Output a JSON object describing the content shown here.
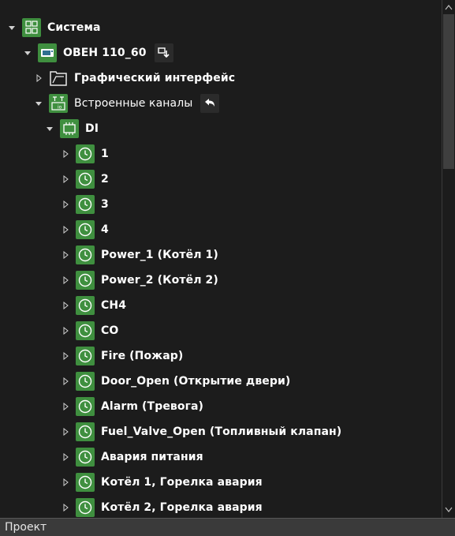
{
  "tree": {
    "items": [
      {
        "label": "Система",
        "icon": "system-icon",
        "expanded": true
      },
      {
        "label": "ОВЕН 110_60",
        "icon": "plc-device-icon",
        "expanded": true,
        "action_icon": "export-download-icon"
      },
      {
        "label": "Графический интерфейс",
        "icon": "graphics-interface-icon",
        "expanded": false
      },
      {
        "label": "Встроенные каналы",
        "icon": "built-in-channels-icon",
        "expanded": true,
        "action_icon": "undo-arrow-icon"
      },
      {
        "label": "DI",
        "icon": "digital-input-chip-icon",
        "expanded": true
      },
      {
        "label": "1",
        "icon": "channel-clock-icon",
        "expanded": false
      },
      {
        "label": "2",
        "icon": "channel-clock-icon",
        "expanded": false
      },
      {
        "label": "3",
        "icon": "channel-clock-icon",
        "expanded": false
      },
      {
        "label": "4",
        "icon": "channel-clock-icon",
        "expanded": false
      },
      {
        "label": "Power_1 (Котёл 1)",
        "icon": "channel-clock-icon",
        "expanded": false
      },
      {
        "label": "Power_2 (Котёл 2)",
        "icon": "channel-clock-icon",
        "expanded": false
      },
      {
        "label": "CH4",
        "icon": "channel-clock-icon",
        "expanded": false
      },
      {
        "label": "CO",
        "icon": "channel-clock-icon",
        "expanded": false
      },
      {
        "label": "Fire (Пожар)",
        "icon": "channel-clock-icon",
        "expanded": false
      },
      {
        "label": "Door_Open (Открытие двери)",
        "icon": "channel-clock-icon",
        "expanded": false
      },
      {
        "label": "Alarm (Тревога)",
        "icon": "channel-clock-icon",
        "expanded": false
      },
      {
        "label": "Fuel_Valve_Open (Топливный клапан)",
        "icon": "channel-clock-icon",
        "expanded": false
      },
      {
        "label": "Авария питания",
        "icon": "channel-clock-icon",
        "expanded": false
      },
      {
        "label": "Котёл 1, Горелка авария",
        "icon": "channel-clock-icon",
        "expanded": false
      },
      {
        "label": "Котёл 2, Горелка авария",
        "icon": "channel-clock-icon",
        "expanded": false
      }
    ]
  },
  "statusbar": {
    "label": "Проект"
  },
  "colors": {
    "background": "#1c1c1c",
    "icon_green": "#3f8f3f",
    "statusbar": "#3a3a3a",
    "scroll_thumb": "#3f3f3f"
  }
}
